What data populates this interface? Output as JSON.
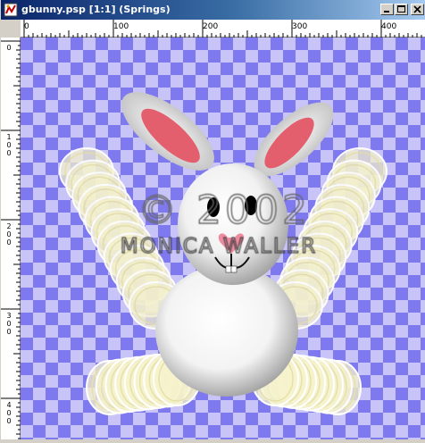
{
  "window": {
    "title": "gbunny.psp [1:1] (Springs)",
    "icon": "psp-document-icon",
    "controls": {
      "minimize_icon": "minimize-icon",
      "maximize_icon": "maximize-icon",
      "close_icon": "close-icon"
    }
  },
  "rulers": {
    "horizontal_labels": [
      "0",
      "100",
      "200",
      "300",
      "400"
    ],
    "vertical_labels": [
      "0",
      "1\n0\n0",
      "2\n0\n0",
      "3\n0\n0",
      "4\n0\n0"
    ]
  },
  "canvas": {
    "checker_colors": [
      "#c8c4f7",
      "#7f79f0"
    ],
    "watermark_line1": "© 2002",
    "watermark_line2": "MONICA WALLER"
  },
  "colors": {
    "titlebar_start": "#0a246a",
    "titlebar_end": "#a6caf0",
    "bunny_white": "#ffffff",
    "ear_pink": "#e35f6e",
    "spring_cream": "#f5f2c8"
  }
}
